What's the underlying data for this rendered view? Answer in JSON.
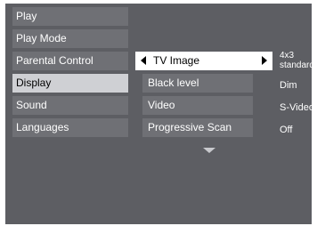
{
  "main_menu": {
    "items": [
      {
        "label": "Play"
      },
      {
        "label": "Play Mode"
      },
      {
        "label": "Parental Control"
      },
      {
        "label": "Display"
      },
      {
        "label": "Sound"
      },
      {
        "label": "Languages"
      }
    ],
    "selected": "Display"
  },
  "sub_menu": {
    "items": [
      {
        "label": "TV Image",
        "value": "4x3 standard",
        "value_line1": "4x3",
        "value_line2": "standard"
      },
      {
        "label": "Black level",
        "value": "Dim"
      },
      {
        "label": "Video",
        "value": "S-Video"
      },
      {
        "label": "Progressive Scan",
        "value": "Off"
      }
    ],
    "focused": "TV Image"
  },
  "icons": {
    "left": "arrow-left-icon",
    "right": "arrow-right-icon",
    "scroll": "scroll-down-icon"
  },
  "colors": {
    "panel": "#5d5e63",
    "item": "#6f7075",
    "selected": "#cfd0d4",
    "focused": "#ffffff"
  }
}
